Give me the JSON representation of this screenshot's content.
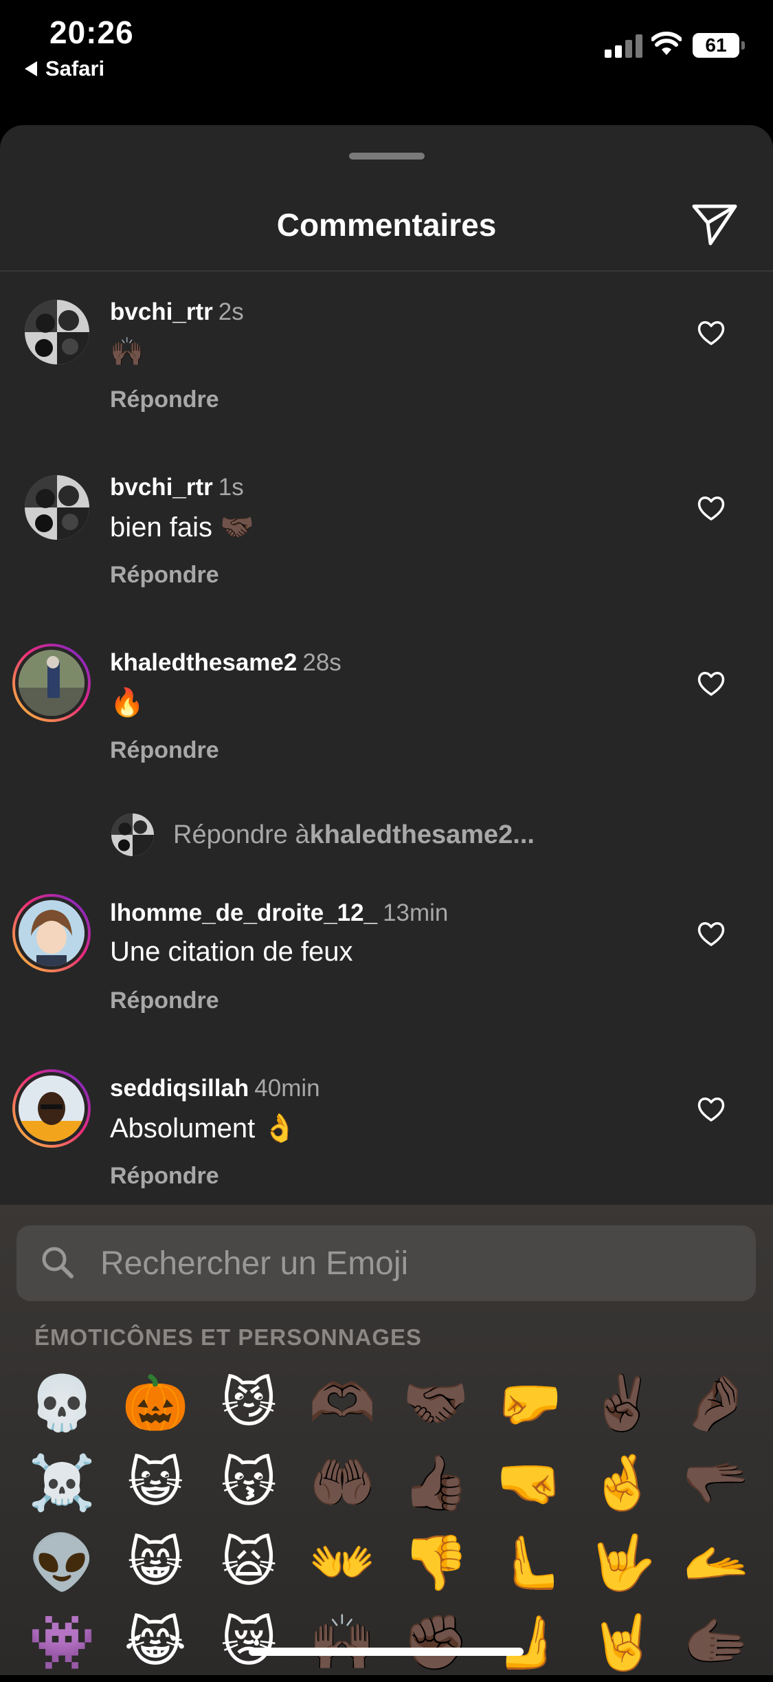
{
  "status_bar": {
    "time": "20:26",
    "back_app": "Safari",
    "battery": "61"
  },
  "sheet": {
    "title": "Commentaires"
  },
  "comments": [
    {
      "username": "bvchi_rtr",
      "time": "2s",
      "text": "🙌🏿",
      "reply_label": "Répondre",
      "avatar": "bw-group",
      "story_ring": false
    },
    {
      "username": "bvchi_rtr",
      "time": "1s",
      "text": "bien fais 🤝🏿",
      "reply_label": "Répondre",
      "avatar": "bw-group",
      "story_ring": false
    },
    {
      "username": "khaledthesame2",
      "time": "28s",
      "text": "🔥",
      "reply_label": "Répondre",
      "avatar": "outdoor-photo",
      "story_ring": true
    },
    {
      "username": "lhomme_de_droite_12_",
      "time": "13min",
      "text": "Une citation de feux",
      "reply_label": "Répondre",
      "avatar": "anime-character",
      "story_ring": true
    },
    {
      "username": "seddiqsillah",
      "time": "40min",
      "text": "Absolument 👌",
      "reply_label": "Répondre",
      "avatar": "portrait-yellow",
      "story_ring": true
    }
  ],
  "reply_to": {
    "prefix": "Répondre à ",
    "username": "khaledthesame2..."
  },
  "emoji_keyboard": {
    "search_placeholder": "Rechercher un Emoji",
    "category": "ÉMOTICÔNES ET PERSONNAGES",
    "emojis": [
      "💀",
      "🎃",
      "😼",
      "🫶🏿",
      "🤝🏿",
      "🤛",
      "✌🏿",
      "🤌🏿",
      "☠️",
      "😺",
      "😽",
      "🤲🏿",
      "👍🏿",
      "🤜",
      "🤞",
      "🫳🏿",
      "👽",
      "😸",
      "🙀",
      "👐",
      "👎",
      "🫷",
      "🤟",
      "🫴",
      "👾",
      "😹",
      "😿",
      "🙌🏿",
      "✊🏿",
      "🫸",
      "🤘",
      "🫱🏿"
    ]
  },
  "icons": {
    "share": "paper-plane-icon",
    "like": "heart-outline-icon",
    "search": "magnifier-icon",
    "signal": "cellular-signal-icon",
    "wifi": "wifi-icon",
    "battery": "battery-icon"
  }
}
